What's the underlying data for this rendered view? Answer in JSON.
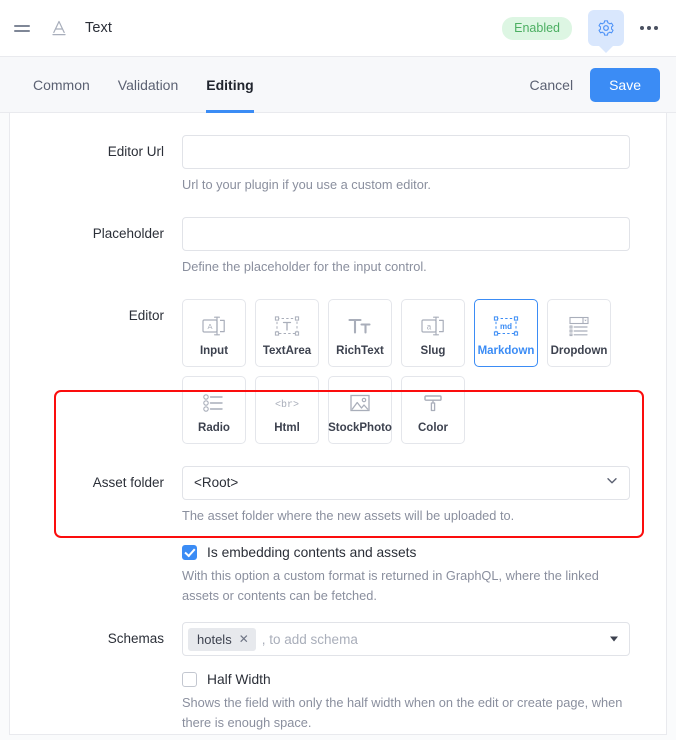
{
  "header": {
    "field_title": "Text",
    "status_badge": "Enabled",
    "drag_handle_icon": "drag-handle-icon",
    "type_icon": "text-type-icon",
    "settings_icon": "gear-icon",
    "more_icon": "more-options-icon"
  },
  "tabbar": {
    "tabs": [
      {
        "label": "Common",
        "active": false
      },
      {
        "label": "Validation",
        "active": false
      },
      {
        "label": "Editing",
        "active": true
      }
    ],
    "cancel_label": "Cancel",
    "save_label": "Save"
  },
  "form": {
    "editor_url": {
      "label": "Editor Url",
      "value": "",
      "placeholder": "",
      "hint": "Url to your plugin if you use a custom editor."
    },
    "placeholder_field": {
      "label": "Placeholder",
      "value": "",
      "placeholder": "",
      "hint": "Define the placeholder for the input control."
    },
    "editor": {
      "label": "Editor",
      "selected": "Markdown",
      "options": [
        {
          "label": "Input",
          "icon": "input-field-icon"
        },
        {
          "label": "TextArea",
          "icon": "textarea-icon"
        },
        {
          "label": "RichText",
          "icon": "richtext-icon"
        },
        {
          "label": "Slug",
          "icon": "slug-icon"
        },
        {
          "label": "Markdown",
          "icon": "markdown-icon"
        },
        {
          "label": "Dropdown",
          "icon": "dropdown-icon"
        },
        {
          "label": "Radio",
          "icon": "radio-list-icon"
        },
        {
          "label": "Html",
          "icon": "html-br-icon"
        },
        {
          "label": "StockPhoto",
          "icon": "stockphoto-icon"
        },
        {
          "label": "Color",
          "icon": "paint-roller-icon"
        }
      ]
    },
    "asset_folder": {
      "label": "Asset folder",
      "value": "<Root>",
      "hint": "The asset folder where the new assets will be uploaded to.",
      "chevron_icon": "chevron-down-icon"
    },
    "embedding": {
      "label": "Is embedding contents and assets",
      "checked": true,
      "hint": "With this option a custom format is returned in GraphQL, where the linked assets or contents can be fetched."
    },
    "schemas": {
      "label": "Schemas",
      "tags": [
        {
          "label": "hotels",
          "remove_icon": "remove-tag-icon"
        }
      ],
      "placeholder": ", to add schema",
      "caret_icon": "caret-down-icon"
    },
    "half_width": {
      "label": "Half Width",
      "checked": false,
      "hint": "Shows the field with only the half width when on the edit or create page, when there is enough space."
    }
  },
  "colors": {
    "accent": "#3b8cf5",
    "badge_bg": "#ddf6e3",
    "badge_text": "#4caf62",
    "highlight": "#fb0d0d",
    "gear_bg": "#d9e7fd"
  }
}
